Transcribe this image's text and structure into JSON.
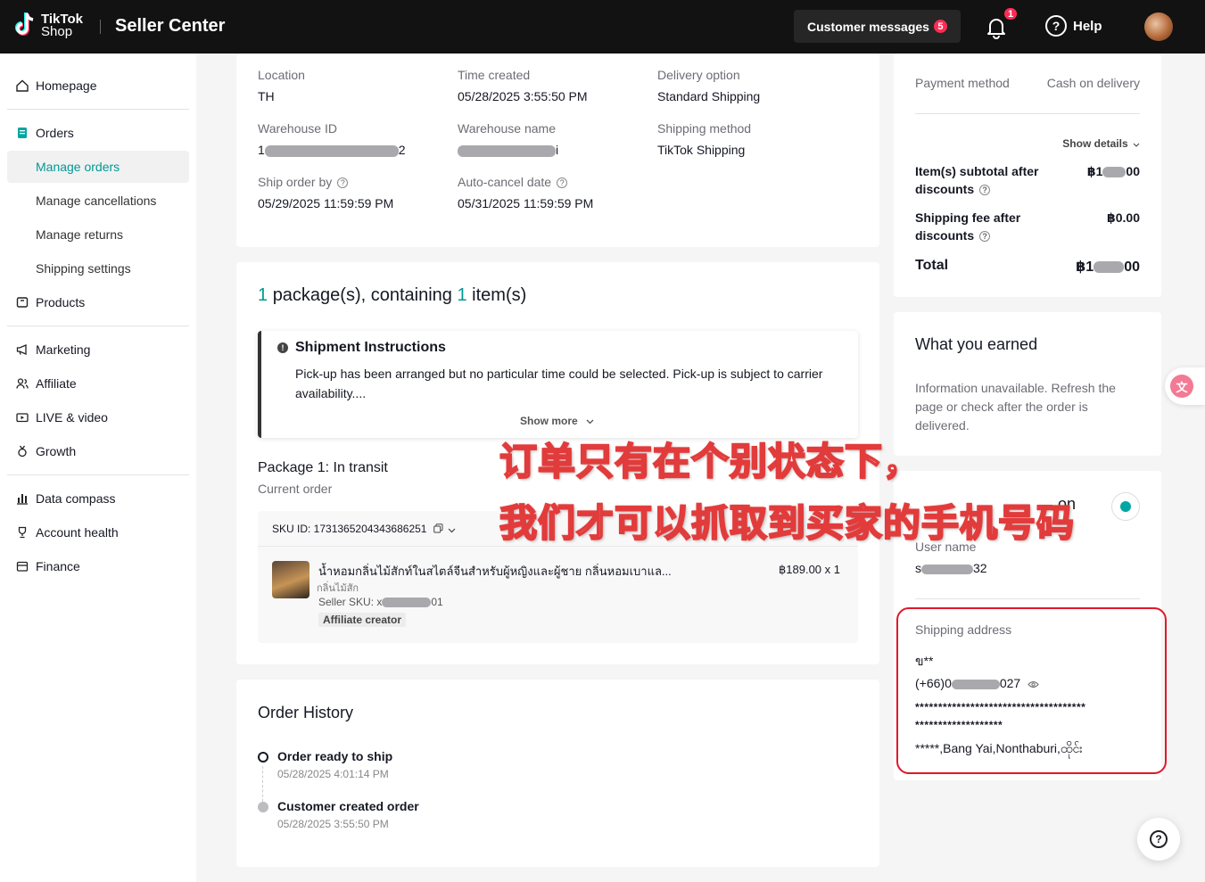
{
  "topbar": {
    "logo_line1": "TikTok",
    "logo_line2": "Shop",
    "app_title": "Seller Center",
    "customer_messages_label": "Customer messages",
    "customer_messages_count": "5",
    "notifications_count": "1",
    "help_label": "Help"
  },
  "sidebar": {
    "homepage": "Homepage",
    "orders": "Orders",
    "manage_orders": "Manage orders",
    "manage_cancellations": "Manage cancellations",
    "manage_returns": "Manage returns",
    "shipping_settings": "Shipping settings",
    "products": "Products",
    "marketing": "Marketing",
    "affiliate": "Affiliate",
    "live_video": "LIVE & video",
    "growth": "Growth",
    "data_compass": "Data compass",
    "account_health": "Account health",
    "finance": "Finance"
  },
  "order_info": {
    "location_label": "Location",
    "location_value": "TH",
    "time_created_label": "Time created",
    "time_created_value": "05/28/2025 3:55:50 PM",
    "delivery_option_label": "Delivery option",
    "delivery_option_value": "Standard Shipping",
    "warehouse_id_label": "Warehouse ID",
    "warehouse_id_prefix": "1",
    "warehouse_id_suffix": "2",
    "warehouse_name_label": "Warehouse name",
    "warehouse_name_suffix": "i",
    "shipping_method_label": "Shipping method",
    "shipping_method_value": "TikTok Shipping",
    "ship_by_label": "Ship order by",
    "ship_by_value": "05/29/2025 11:59:59 PM",
    "auto_cancel_label": "Auto-cancel date",
    "auto_cancel_value": "05/31/2025 11:59:59 PM"
  },
  "package": {
    "count": "1",
    "title_mid": "package(s), containing",
    "item_count": "1",
    "title_end": "item(s)",
    "instructions_title": "Shipment Instructions",
    "instructions_text": "Pick-up has been arranged but no particular time could be selected. Pick-up is subject to carrier availability....",
    "show_more": "Show more",
    "package_status": "Package 1: In transit",
    "current_order": "Current order",
    "sku_id": "SKU ID: 1731365204343686251",
    "product_name": "น้ำหอมกลิ่นไม้สักท์ในสไตล์จีนสำหรับผู้หญิงและผู้ชาย กลิ่นหอมเบาแล...",
    "product_variant": "กลิ่นไม้สัก",
    "seller_sku_label": "Seller SKU: x",
    "seller_sku_suffix": "01",
    "affiliate_tag": "Affiliate creator",
    "price": "฿189.00 x 1"
  },
  "history": {
    "title": "Order History",
    "events": [
      {
        "label": "Order ready to ship",
        "time": "05/28/2025 4:01:14 PM"
      },
      {
        "label": "Customer created order",
        "time": "05/28/2025 3:55:50 PM"
      }
    ]
  },
  "payment": {
    "method_label": "Payment method",
    "method_value": "Cash on delivery",
    "show_details": "Show details",
    "subtotal_label": "Item(s) subtotal after discounts",
    "subtotal_prefix": "฿1",
    "subtotal_suffix": "00",
    "shipping_fee_label": "Shipping fee after discounts",
    "shipping_fee_value": "฿0.00",
    "total_label": "Total",
    "total_prefix": "฿1",
    "total_suffix": "00"
  },
  "earned": {
    "title": "What you earned",
    "text": "Information unavailable. Refresh the page or check after the order is delivered."
  },
  "customer": {
    "title_suffix": "on",
    "user_name_label": "User name",
    "user_name_prefix": "s",
    "user_name_suffix": "32",
    "shipping_address_label": "Shipping address",
    "name": "ข**",
    "phone_prefix": "(+66)0",
    "phone_suffix": "027",
    "address_line1": "*************************************",
    "address_line2": "*******************",
    "address_line3": "*****,Bang Yai,Nonthaburi,ထိုင်း"
  },
  "overlay": {
    "line1": "订单只有在个别状态下，",
    "line2": "我们才可以抓取到买家的手机号码"
  },
  "colors": {
    "accent": "#009995",
    "topbar": "#121212",
    "badge": "#fe2c55",
    "highlight_border": "#e0182a"
  }
}
